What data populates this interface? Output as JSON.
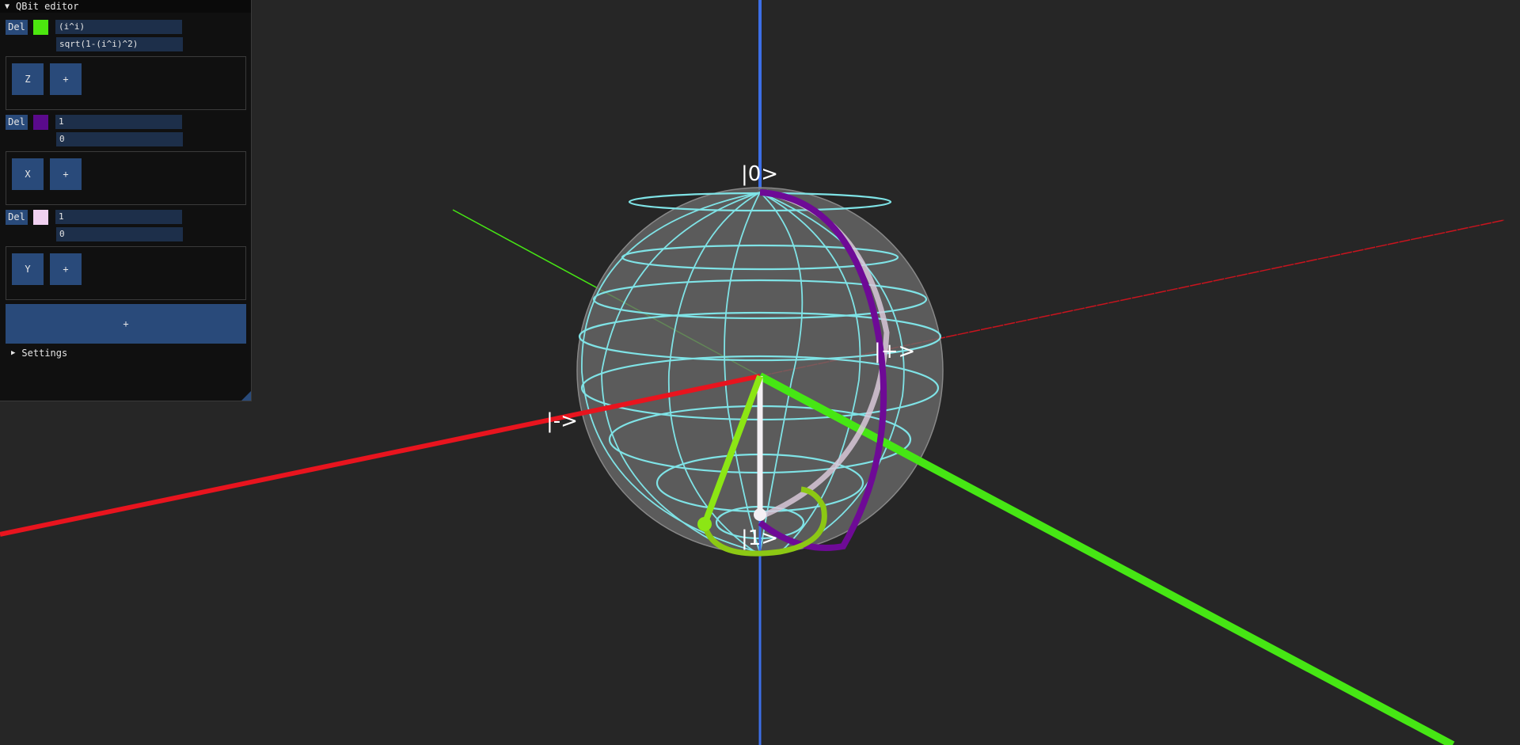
{
  "window": {
    "title": "QBit editor",
    "collapse_icon": "triangle-down"
  },
  "qbits": [
    {
      "delete_label": "Del",
      "color": "#4ce60f",
      "amplitude_0": "(i^i)",
      "amplitude_1": "sqrt(1-(i^i)^2)",
      "gates": [
        "Z"
      ],
      "add_gate_label": "+"
    },
    {
      "delete_label": "Del",
      "color": "#5a0a8c",
      "amplitude_0": "1",
      "amplitude_1": "0",
      "gates": [
        "X"
      ],
      "add_gate_label": "+"
    },
    {
      "delete_label": "Del",
      "color": "#f0d0f0",
      "amplitude_0": "1",
      "amplitude_1": "0",
      "gates": [
        "Y"
      ],
      "add_gate_label": "+"
    }
  ],
  "add_qbit_label": "+",
  "settings": {
    "label": "Settings",
    "expand_icon": "triangle-right"
  },
  "scene": {
    "labels": {
      "ket_zero": "|0>",
      "ket_one": "|1>",
      "ket_plus": "|+>",
      "ket_minus": "|->"
    },
    "colors": {
      "background": "#262626",
      "x_axis": "#e8141e",
      "y_axis": "#46e614",
      "z_axis": "#3c6ee6",
      "sphere": "#6a6a6a",
      "grid": "#7fe3e6",
      "state_green": "#8ce614",
      "state_purple": "#6e0a96",
      "state_pink": "#d8c8d8"
    }
  }
}
